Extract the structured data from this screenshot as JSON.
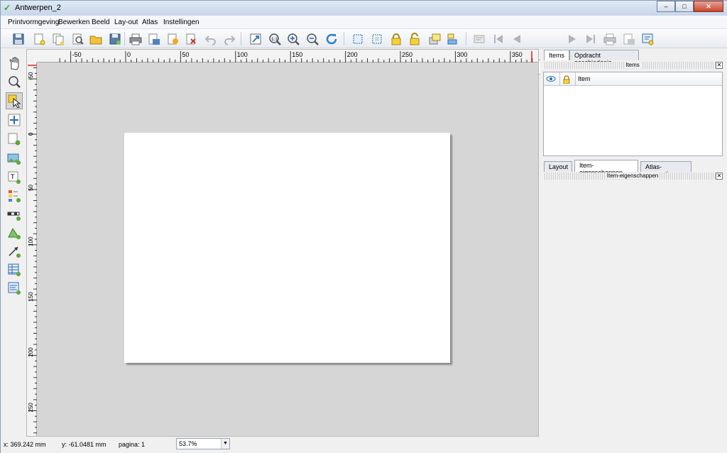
{
  "window": {
    "title": "Antwerpen_2",
    "minimize": "–",
    "maximize": "□",
    "close": "✕"
  },
  "menu": [
    "Printvormgeving",
    "Bewerken",
    "Beeld",
    "Lay-out",
    "Atlas",
    "Instellingen"
  ],
  "toolbar": {
    "icons": [
      "save-icon",
      "new-composer-icon",
      "duplicate-composer-icon",
      "composer-manager-icon",
      "open-template-icon",
      "save-template-icon",
      "print-icon",
      "export-image-icon",
      "export-svg-icon",
      "export-pdf-icon",
      "undo-icon",
      "redo-icon",
      "zoom-full-icon",
      "zoom-100-icon",
      "zoom-in-icon",
      "zoom-out-icon",
      "refresh-icon",
      "select-all-icon",
      "deselect-icon",
      "lock-icon",
      "unlock-icon",
      "raise-icon",
      "align-icon",
      "atlas-preview-icon",
      "first-feature-icon",
      "previous-feature-icon",
      "next-feature-icon",
      "last-feature-icon",
      "atlas-print-icon",
      "atlas-export-icon",
      "atlas-settings-icon"
    ],
    "page_value": "1"
  },
  "lefttools": [
    "pan-icon",
    "zoom-tool-icon",
    "select-move-icon",
    "move-content-icon",
    "add-map-icon",
    "add-image-icon",
    "add-label-icon",
    "add-legend-icon",
    "add-scalebar-icon",
    "add-shape-icon",
    "add-arrow-icon",
    "add-table-icon",
    "add-html-icon"
  ],
  "ruler": {
    "h_labels": [
      "-50",
      "0",
      "50",
      "100",
      "150",
      "200",
      "250",
      "300",
      "350"
    ],
    "v_labels": [
      "-50",
      "0",
      "50",
      "100",
      "150",
      "200",
      "250"
    ]
  },
  "status": {
    "x": "x: 369.242 mm",
    "y": "y: -61.0481 mm",
    "page": "pagina: 1",
    "zoom": "53.7%"
  },
  "panel": {
    "tabs_top": [
      "Items",
      "Opdracht geschiedenis"
    ],
    "items_title": "Items",
    "items_column": "Item",
    "tabs_bottom": [
      "Layout",
      "Item-eigenschappen",
      "Atlas-generatie"
    ],
    "props_title": "Item-eigenschappen",
    "close": "✕"
  },
  "colors": {
    "accent": "#f5d23a",
    "canvas": "#d6d6d6",
    "paper": "#ffffff"
  }
}
